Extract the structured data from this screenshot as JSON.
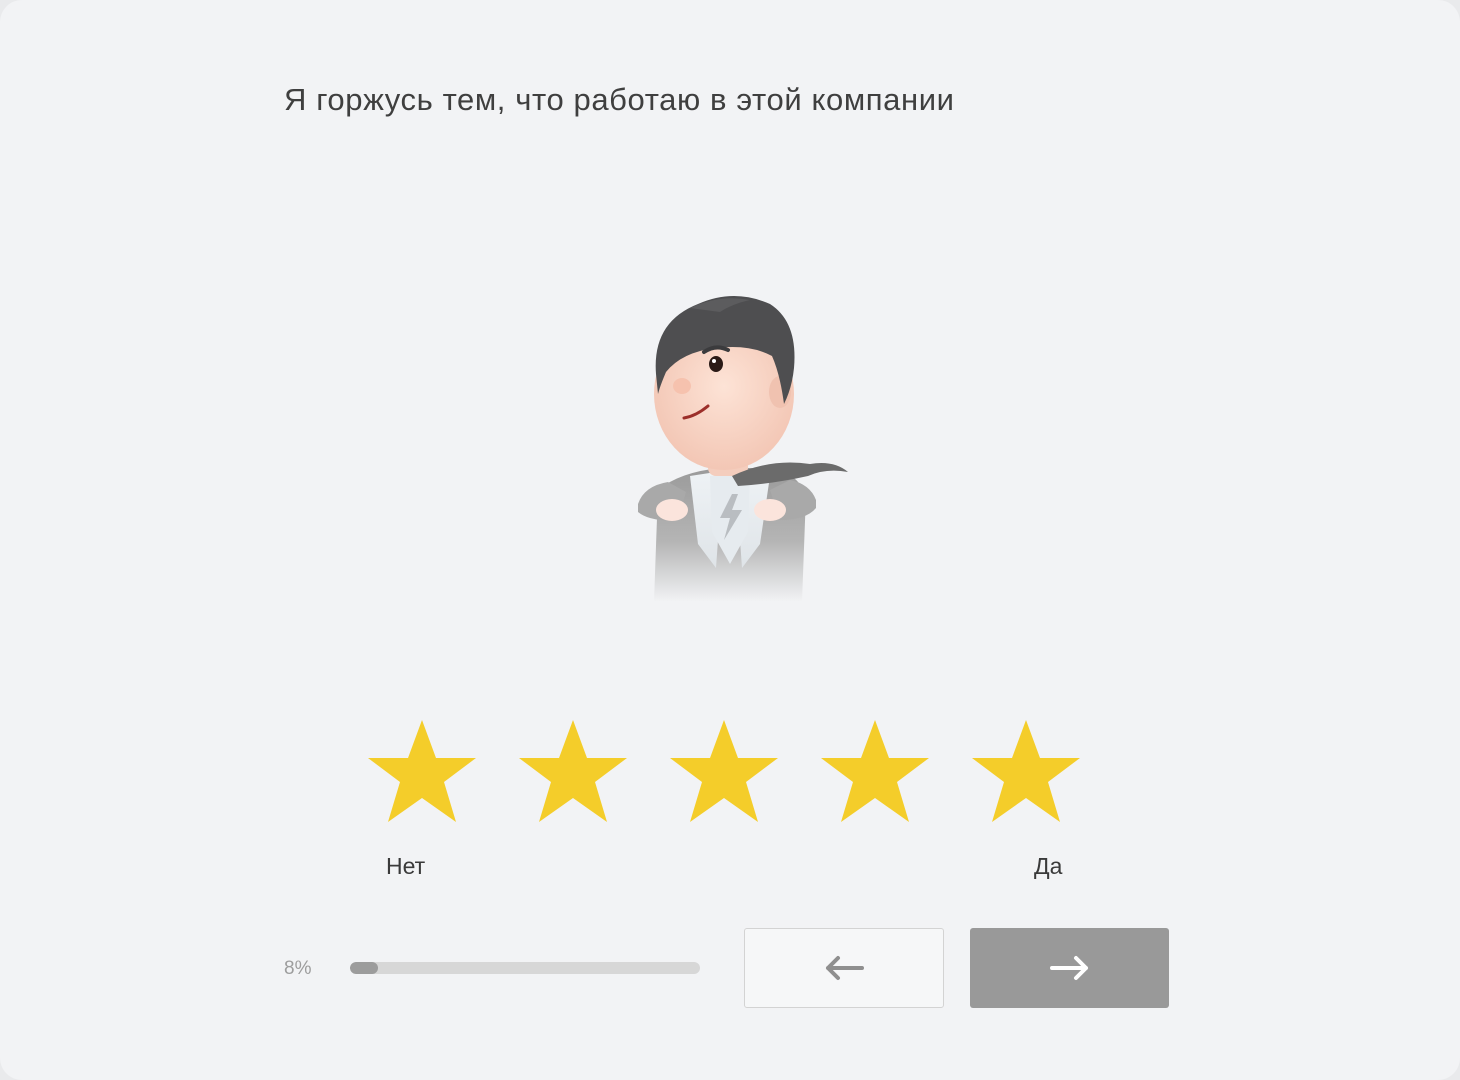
{
  "question": {
    "text": "Я горжусь тем, что работаю в этой компании"
  },
  "illustration": {
    "icon": "businessman-superhero-illustration"
  },
  "rating": {
    "max": 5,
    "value": 5,
    "star_color": "#f4cd2a",
    "left_label": "Нет",
    "right_label": "Да"
  },
  "progress": {
    "label": "8%",
    "value": 0.08,
    "track_color": "#d7d7d7",
    "fill_color": "#9c9c9c"
  },
  "navigation": {
    "prev_icon": "arrow-left-icon",
    "next_icon": "arrow-right-icon"
  }
}
